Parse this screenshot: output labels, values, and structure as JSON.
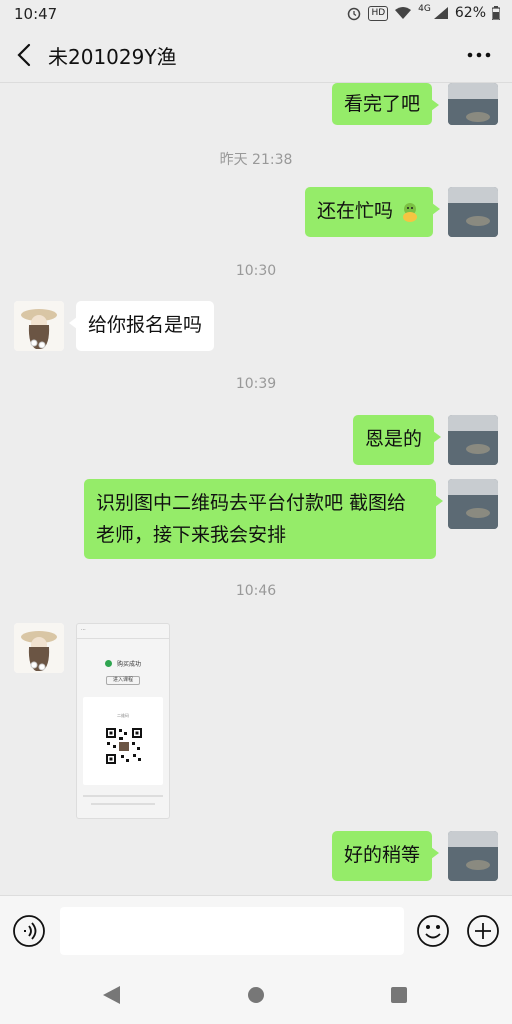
{
  "status_bar": {
    "time": "10:47",
    "battery": "62%",
    "network": "4G",
    "hd_label": "HD"
  },
  "header": {
    "title": "未201029Y渔",
    "back_icon": "chevron-left-icon",
    "more_icon": "more-dots-icon"
  },
  "messages": [
    {
      "type": "text",
      "from": "self",
      "text": "看完了吧"
    },
    {
      "type": "timestamp",
      "text": "昨天 21:38"
    },
    {
      "type": "text",
      "from": "self",
      "text": "还在忙吗",
      "emoji": "green-face-emoji"
    },
    {
      "type": "timestamp",
      "text": "10:30"
    },
    {
      "type": "text",
      "from": "peer",
      "text": "给你报名是吗"
    },
    {
      "type": "timestamp",
      "text": "10:39"
    },
    {
      "type": "text",
      "from": "self",
      "text": "恩是的"
    },
    {
      "type": "text",
      "from": "self",
      "text": "识别图中二维码去平台付款吧 截图给老师，接下来我会安排"
    },
    {
      "type": "timestamp",
      "text": "10:46"
    },
    {
      "type": "image",
      "from": "peer",
      "image": {
        "top_line": "...",
        "success_text": "购买成功",
        "button": "进入课程",
        "qr_label": "二维码"
      }
    },
    {
      "type": "text",
      "from": "self",
      "text": "好的稍等"
    }
  ],
  "input_bar": {
    "placeholder": "",
    "value": "",
    "voice_icon": "voice-icon",
    "emoji_icon": "emoji-icon",
    "plus_icon": "plus-icon"
  },
  "system_nav": {
    "back": "nav-back-icon",
    "home": "nav-home-icon",
    "recent": "nav-recent-icon"
  },
  "colors": {
    "bubble_out": "#95ec69",
    "bubble_in": "#ffffff",
    "background": "#ededed"
  }
}
